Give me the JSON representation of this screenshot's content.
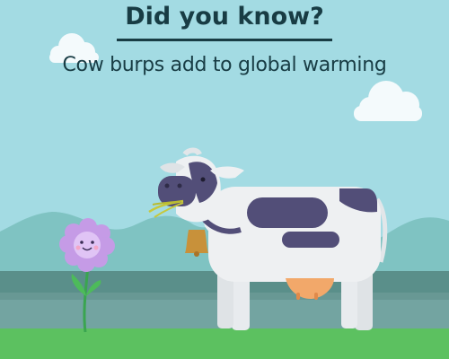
{
  "header": {
    "title": "Did you know?",
    "subtitle": "Cow burps add to global warming"
  },
  "colors": {
    "sky": "#a3dbe3",
    "heading_text": "#183c44",
    "hills": "#7fc3c2",
    "mid_ground": "#5a8f8a",
    "grass": "#5cc160",
    "cow_body": "#eef0f2",
    "cow_spots": "#524e78",
    "udder": "#f2a86a",
    "bell": "#c8913a",
    "flower_petals": "#c59be6",
    "flower_stem": "#3aa550"
  }
}
